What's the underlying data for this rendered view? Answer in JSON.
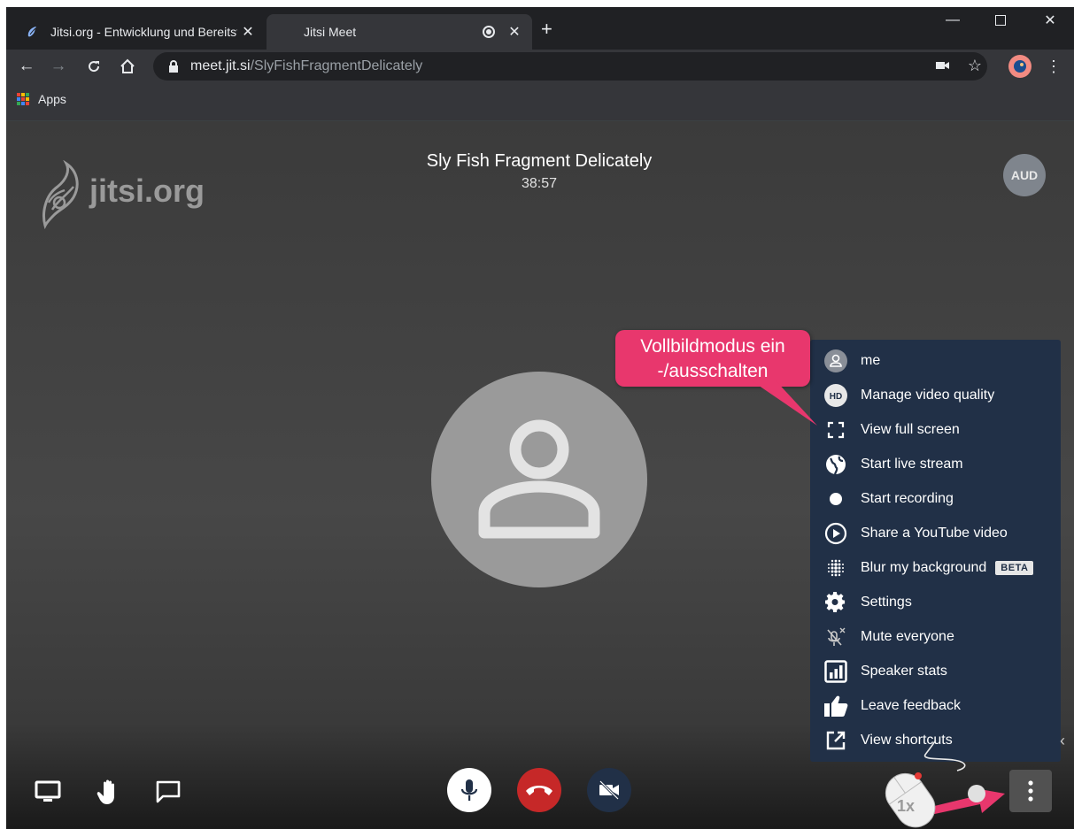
{
  "browser": {
    "tabs": [
      {
        "title": "Jitsi.org - Entwicklung und Bereitstellung",
        "active": false
      },
      {
        "title": "Jitsi Meet",
        "active": true
      }
    ],
    "url_host": "meet.jit.si",
    "url_path": "/SlyFishFragmentDelicately",
    "bookmarks": [
      {
        "label": "Apps"
      }
    ]
  },
  "meeting": {
    "logo_text": "jitsi.org",
    "title": "Sly Fish Fragment Delicately",
    "timer": "38:57",
    "participant_badge": "AUD"
  },
  "overflow_menu": {
    "items": [
      {
        "label": "me",
        "icon": "user-icon"
      },
      {
        "label": "Manage video quality",
        "icon": "hd-icon"
      },
      {
        "label": "View full screen",
        "icon": "fullscreen-icon"
      },
      {
        "label": "Start live stream",
        "icon": "globe-icon"
      },
      {
        "label": "Start recording",
        "icon": "record-icon"
      },
      {
        "label": "Share a YouTube video",
        "icon": "play-icon"
      },
      {
        "label": "Blur my background",
        "icon": "blur-icon",
        "badge": "BETA"
      },
      {
        "label": "Settings",
        "icon": "gear-icon"
      },
      {
        "label": "Mute everyone",
        "icon": "mic-off-icon"
      },
      {
        "label": "Speaker stats",
        "icon": "bar-chart-icon"
      },
      {
        "label": "Leave feedback",
        "icon": "thumbs-up-icon"
      },
      {
        "label": "View shortcuts",
        "icon": "external-link-icon"
      }
    ]
  },
  "callout": {
    "line1": "Vollbildmodus ein",
    "line2": "-/ausschalten",
    "color": "#e8376d"
  },
  "mouse_hint": {
    "label": "1x"
  },
  "colors": {
    "menu_bg": "#213047",
    "hangup": "#c62828",
    "chrome_bg": "#202124"
  }
}
